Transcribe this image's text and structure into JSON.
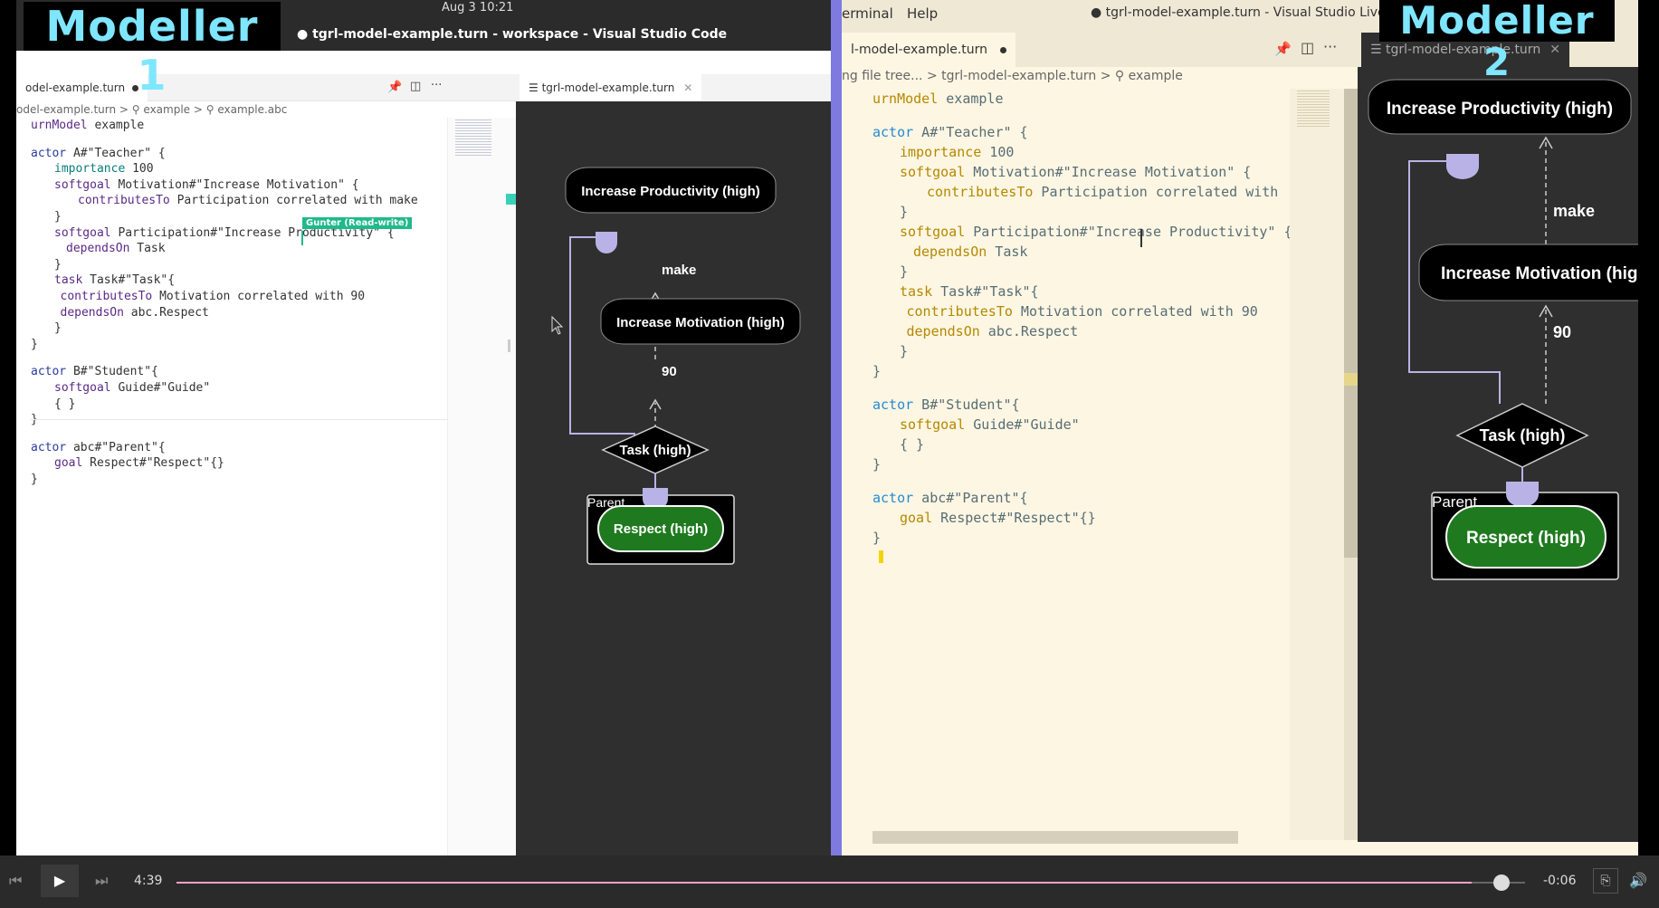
{
  "labels": {
    "modeller1": "Modeller 1",
    "modeller2": "Modeller 2",
    "clock": "Aug 3  10:21",
    "window_title_left": "tgrl-model-example.turn - workspace - Visual Studio Code",
    "window_title_right": "tgrl-model-example.turn - Visual Studio Live Share",
    "menu_terminal": "erminal",
    "menu_help": "Help"
  },
  "left_editor": {
    "tab_label": "odel-example.turn",
    "diagram_tab_label": "tgrl-model-example.turn",
    "breadcrumb": "odel-example.turn > ⚲ example > ⚲ example.abc",
    "cursor_flag": "Gunter (Read-write)"
  },
  "right_editor": {
    "tab_label": "l-model-example.turn",
    "diagram_tab_label": "tgrl-model-example.turn",
    "breadcrumb": "ng file tree...  >  tgrl-model-example.turn  >  ⚲ example"
  },
  "code_lines": [
    {
      "indent": 0,
      "parts": [
        {
          "t": "urnModel",
          "c": "kw"
        },
        {
          "t": " example",
          "c": ""
        }
      ]
    },
    {
      "indent": 0,
      "parts": [
        {
          "t": "",
          "c": ""
        }
      ]
    },
    {
      "indent": 0,
      "parts": [
        {
          "t": "actor",
          "c": "kwblue"
        },
        {
          "t": " A#\"Teacher\" {",
          "c": ""
        }
      ]
    },
    {
      "indent": 1,
      "parts": [
        {
          "t": "importance",
          "c": "kw2"
        },
        {
          "t": " 100",
          "c": ""
        }
      ]
    },
    {
      "indent": 1,
      "parts": [
        {
          "t": "softgoal",
          "c": "kw"
        },
        {
          "t": " Motivation#\"Increase Motivation\" {",
          "c": ""
        }
      ]
    },
    {
      "indent": 2,
      "parts": [
        {
          "t": "contributesTo",
          "c": "kw"
        },
        {
          "t": " Participation correlated with make",
          "c": ""
        }
      ]
    },
    {
      "indent": 1,
      "parts": [
        {
          "t": "}",
          "c": ""
        }
      ]
    },
    {
      "indent": 1,
      "parts": [
        {
          "t": "softgoal",
          "c": "kw"
        },
        {
          "t": " Participation#\"Increase Productivity\" {",
          "c": ""
        }
      ]
    },
    {
      "indent": 1.5,
      "parts": [
        {
          "t": "dependsOn",
          "c": "kw"
        },
        {
          "t": " Task",
          "c": ""
        }
      ]
    },
    {
      "indent": 1,
      "parts": [
        {
          "t": "}",
          "c": ""
        }
      ]
    },
    {
      "indent": 1,
      "parts": [
        {
          "t": "task",
          "c": "kw"
        },
        {
          "t": " Task#\"Task\"{",
          "c": ""
        }
      ]
    },
    {
      "indent": 1.25,
      "parts": [
        {
          "t": "contributesTo",
          "c": "kw"
        },
        {
          "t": " Motivation correlated with 90",
          "c": ""
        }
      ]
    },
    {
      "indent": 1.25,
      "parts": [
        {
          "t": "dependsOn",
          "c": "kw"
        },
        {
          "t": " abc.Respect",
          "c": ""
        }
      ]
    },
    {
      "indent": 1,
      "parts": [
        {
          "t": "}",
          "c": ""
        }
      ]
    },
    {
      "indent": 0,
      "parts": [
        {
          "t": "}",
          "c": ""
        }
      ]
    },
    {
      "indent": 0,
      "parts": [
        {
          "t": "",
          "c": ""
        }
      ]
    },
    {
      "indent": 0,
      "parts": [
        {
          "t": "actor",
          "c": "kwblue"
        },
        {
          "t": " B#\"Student\"{",
          "c": ""
        }
      ]
    },
    {
      "indent": 1,
      "parts": [
        {
          "t": "softgoal",
          "c": "kw"
        },
        {
          "t": " Guide#\"Guide\"",
          "c": ""
        }
      ]
    },
    {
      "indent": 1,
      "parts": [
        {
          "t": "{ }",
          "c": ""
        }
      ]
    },
    {
      "indent": 0,
      "parts": [
        {
          "t": "}",
          "c": ""
        }
      ]
    },
    {
      "indent": 0,
      "parts": [
        {
          "t": "",
          "c": ""
        }
      ]
    },
    {
      "indent": 0,
      "parts": [
        {
          "t": "actor",
          "c": "kwblue"
        },
        {
          "t": " abc#\"Parent\"{",
          "c": ""
        }
      ]
    },
    {
      "indent": 1,
      "parts": [
        {
          "t": "goal",
          "c": "kw"
        },
        {
          "t": " Respect#\"Respect\"{}",
          "c": ""
        }
      ]
    },
    {
      "indent": 0,
      "parts": [
        {
          "t": "}",
          "c": ""
        }
      ]
    }
  ],
  "right_code_overrides": {
    "5": "contributesTo Participation correlated with"
  },
  "diagram": {
    "node_productivity": "Increase Productivity (high)",
    "node_motivation": "Increase Motivation (high)",
    "node_motivation_right": "Increase Motivation (hig",
    "node_task": "Task (high)",
    "node_respect": "Respect (high)",
    "actor_parent": "Parent",
    "link_make": "make",
    "link_90": "90"
  },
  "player": {
    "current_time": "4:39",
    "remaining_time": "-0:06",
    "progress": 0.98
  },
  "colors": {
    "badge_text": "#7fe6ff",
    "divider": "#7e7ae0",
    "respect_fill": "#1f7a1f",
    "dependency": "#b9b2e6"
  }
}
